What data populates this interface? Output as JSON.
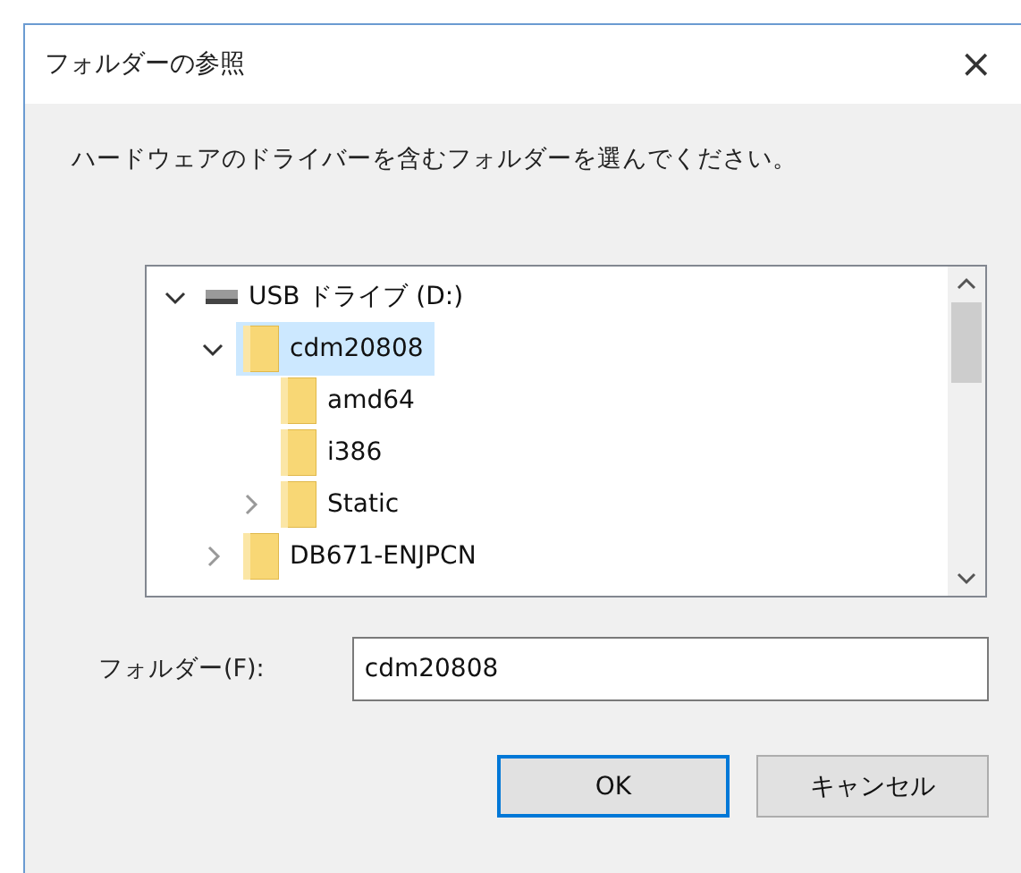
{
  "window": {
    "title": "フォルダーの参照",
    "close": "×"
  },
  "instruction": "ハードウェアのドライバーを含むフォルダーを選んでください。",
  "tree": [
    {
      "label": "USB ドライブ (D:)",
      "kind": "drive",
      "expanded": true,
      "selected": false,
      "children": [
        {
          "label": "cdm20808",
          "kind": "folder",
          "expanded": true,
          "selected": true,
          "children": [
            {
              "label": "amd64",
              "kind": "folder",
              "selected": false
            },
            {
              "label": "i386",
              "kind": "folder",
              "selected": false
            },
            {
              "label": "Static",
              "kind": "folder",
              "expanded": false,
              "selected": false
            }
          ]
        },
        {
          "label": "DB671-ENJPCN",
          "kind": "folder",
          "expanded": false,
          "selected": false
        }
      ]
    }
  ],
  "folder_field": {
    "label": "フォルダー(F):",
    "value": "cdm20808"
  },
  "buttons": [
    {
      "label": "OK",
      "default": true
    },
    {
      "label": "キャンセル",
      "default": false
    }
  ]
}
